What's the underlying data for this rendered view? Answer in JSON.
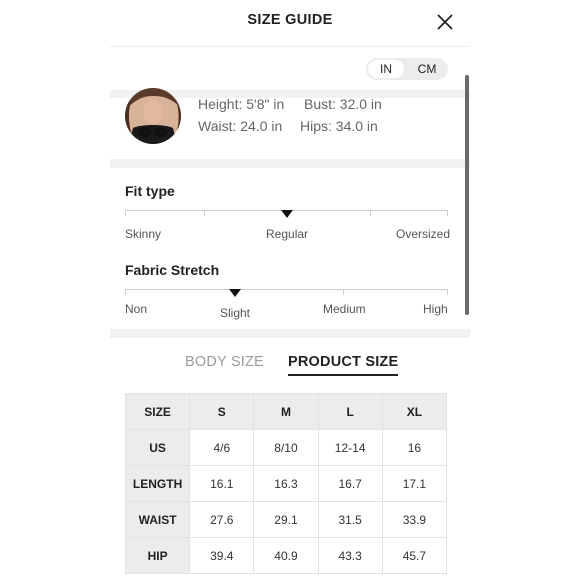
{
  "header": {
    "title": "SIZE GUIDE",
    "close_icon": "close-icon"
  },
  "units": {
    "in_label": "IN",
    "cm_label": "CM",
    "selected": "IN"
  },
  "model": {
    "avatar_icon": "model-photo",
    "height": "Height: 5'8\" in",
    "bust": "Bust: 32.0 in",
    "waist": "Waist: 24.0 in",
    "hips": "Hips: 34.0 in"
  },
  "fit_type": {
    "title": "Fit type",
    "labels": [
      "Skinny",
      "Regular",
      "Oversized"
    ],
    "selected_fraction": 0.5
  },
  "fabric_stretch": {
    "title": "Fabric Stretch",
    "labels": [
      "Non",
      "Slight",
      "Medium",
      "High"
    ],
    "selected_fraction": 0.33
  },
  "tabs": {
    "body_size": "BODY SIZE",
    "product_size": "PRODUCT SIZE",
    "active": "PRODUCT SIZE"
  },
  "table": {
    "header": [
      "SIZE",
      "S",
      "M",
      "L",
      "XL"
    ],
    "rows": [
      {
        "label": "US",
        "values": [
          "4/6",
          "8/10",
          "12-14",
          "16"
        ]
      },
      {
        "label": "LENGTH",
        "values": [
          "16.1",
          "16.3",
          "16.7",
          "17.1"
        ]
      },
      {
        "label": "WAIST",
        "values": [
          "27.6",
          "29.1",
          "31.5",
          "33.9"
        ]
      },
      {
        "label": "HIP",
        "values": [
          "39.4",
          "40.9",
          "43.3",
          "45.7"
        ]
      }
    ]
  },
  "colors": {
    "accent": "#222222",
    "muted": "#9a9a9a",
    "header_bg": "#ececec"
  }
}
